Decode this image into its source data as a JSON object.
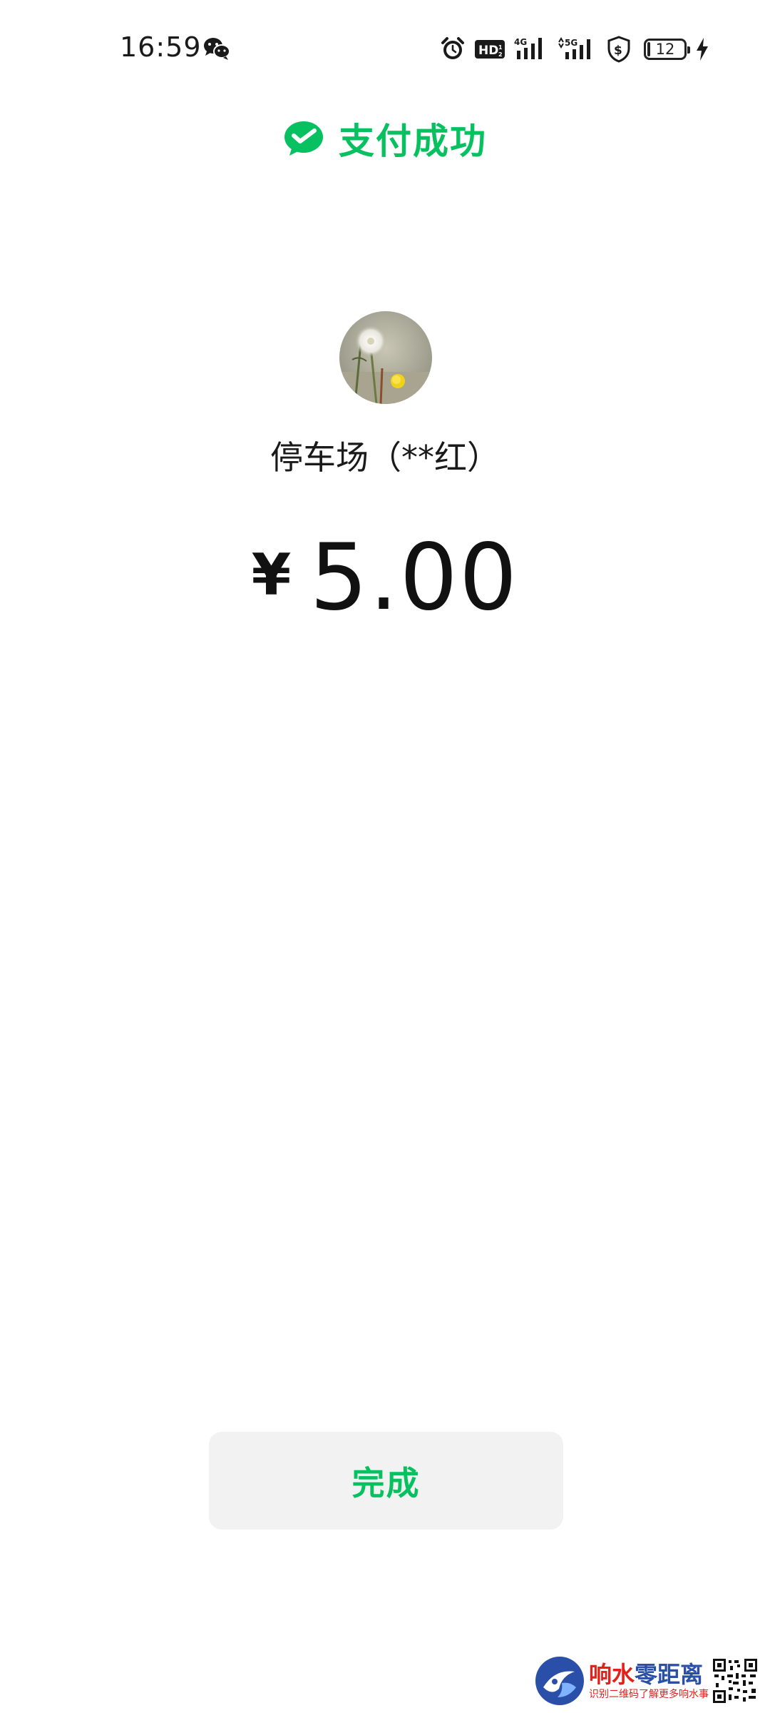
{
  "status_bar": {
    "time": "16:59",
    "network_4g": "4G",
    "network_5g": "5G",
    "hd_label": "HD",
    "battery_level": "12"
  },
  "header": {
    "title": "支付成功"
  },
  "merchant": {
    "name": "停车场（**红）"
  },
  "payment": {
    "currency_symbol": "¥",
    "amount": "5.00"
  },
  "actions": {
    "done_label": "完成"
  },
  "watermark": {
    "title_part1": "响水",
    "title_part2": "零距离",
    "subtitle": "识别二维码了解更多响水事"
  },
  "colors": {
    "brand_green": "#07c160",
    "button_bg": "#f2f2f2"
  }
}
